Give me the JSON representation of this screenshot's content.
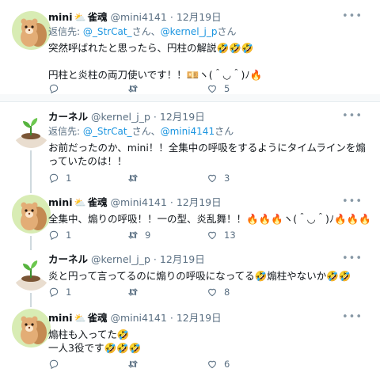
{
  "tweets": [
    {
      "name": "mini",
      "name_emoji": "⛅",
      "name_suffix": "雀魂",
      "handle": "@mini4141",
      "date": "12月19日",
      "reply_prefix": "返信先: ",
      "reply_user1": "@_StrCat_",
      "reply_mid": "さん、",
      "reply_user2": "@kernel_j_p",
      "reply_suffix": "さん",
      "text": "突然呼ばれたと思ったら、円柱の解説🤣🤣🤣\n\n円柱と炎柱の両刀使いです！！💴ヽ(＾◡＾)ﾉ🔥",
      "reply_count": "",
      "retweet_count": "",
      "like_count": "5"
    },
    {
      "name": "カーネル",
      "handle": "@kernel_j_p",
      "date": "12月19日",
      "reply_prefix": "返信先: ",
      "reply_user1": "@_StrCat_",
      "reply_mid": "さん、",
      "reply_user2": "@mini4141",
      "reply_suffix": "さん",
      "text": "お前だったのか、mini！！全集中の呼吸をするようにタイムラインを煽っていたのは！！",
      "reply_count": "1",
      "retweet_count": "",
      "like_count": "3"
    },
    {
      "name": "mini",
      "name_emoji": "⛅",
      "name_suffix": "雀魂",
      "handle": "@mini4141",
      "date": "12月19日",
      "text": "全集中、煽りの呼吸！！一の型、炎乱舞！！🔥🔥🔥ヽ(＾◡＾)ﾉ🔥🔥🔥",
      "reply_count": "1",
      "retweet_count": "9",
      "like_count": "13"
    },
    {
      "name": "カーネル",
      "handle": "@kernel_j_p",
      "date": "12月19日",
      "text": "炎と円って言ってるのに煽りの呼吸になってる🤣煽柱やないか🤣🤣",
      "reply_count": "1",
      "retweet_count": "",
      "like_count": "8"
    },
    {
      "name": "mini",
      "name_emoji": "⛅",
      "name_suffix": "雀魂",
      "handle": "@mini4141",
      "date": "12月19日",
      "text": "煽柱も入ってた🤣\n一人3役です🤣🤣🤣",
      "reply_count": "",
      "retweet_count": "",
      "like_count": "6"
    }
  ],
  "more_label": "•••",
  "separator": "·",
  "colors": {
    "link": "#1b95e0",
    "muted": "#5b7083",
    "border": "#e6ecf0"
  }
}
